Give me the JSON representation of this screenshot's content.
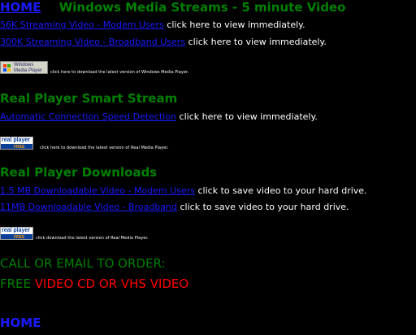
{
  "header": {
    "home": "HOME",
    "title": "Windows Media Streams  -  5 minute Video"
  },
  "wms": {
    "modem_link": "56K Streaming Video - Modem Users",
    "modem_text": " click here to view immediately.",
    "broadband_link": "300K Streaming Video - Broadband Users",
    "broadband_text": " click here to view immediately.",
    "badge_line1": "Windows",
    "badge_line2": "Media Player",
    "download_note": "click here to download the latest version of Windows Media Player."
  },
  "real_stream": {
    "heading": "Real Player Smart Stream",
    "link": "Automatic Connection Speed Detection",
    "text": " click here to view immediately.",
    "badge_main": "real player",
    "badge_sub": "FREE",
    "download_note": "click here to download the latest version of Real Media Player."
  },
  "real_downloads": {
    "heading": "Real Player Downloads",
    "modem_link": "1.5 MB Downloadable Video - Modem Users",
    "modem_text": " click to save video to your hard drive.",
    "broadband_link": "11MB Downloadable Video - Broadband",
    "broadband_text": " click to save video to your hard drive.",
    "badge_main": "real player",
    "badge_sub": "FREE",
    "download_note": "click download the latest version of Real Media Player."
  },
  "order": {
    "call": "CALL OR EMAIL TO ORDER:",
    "free": "FREE ",
    "offer": "VIDEO CD OR VHS VIDEO"
  },
  "footer": {
    "home": "HOME"
  }
}
